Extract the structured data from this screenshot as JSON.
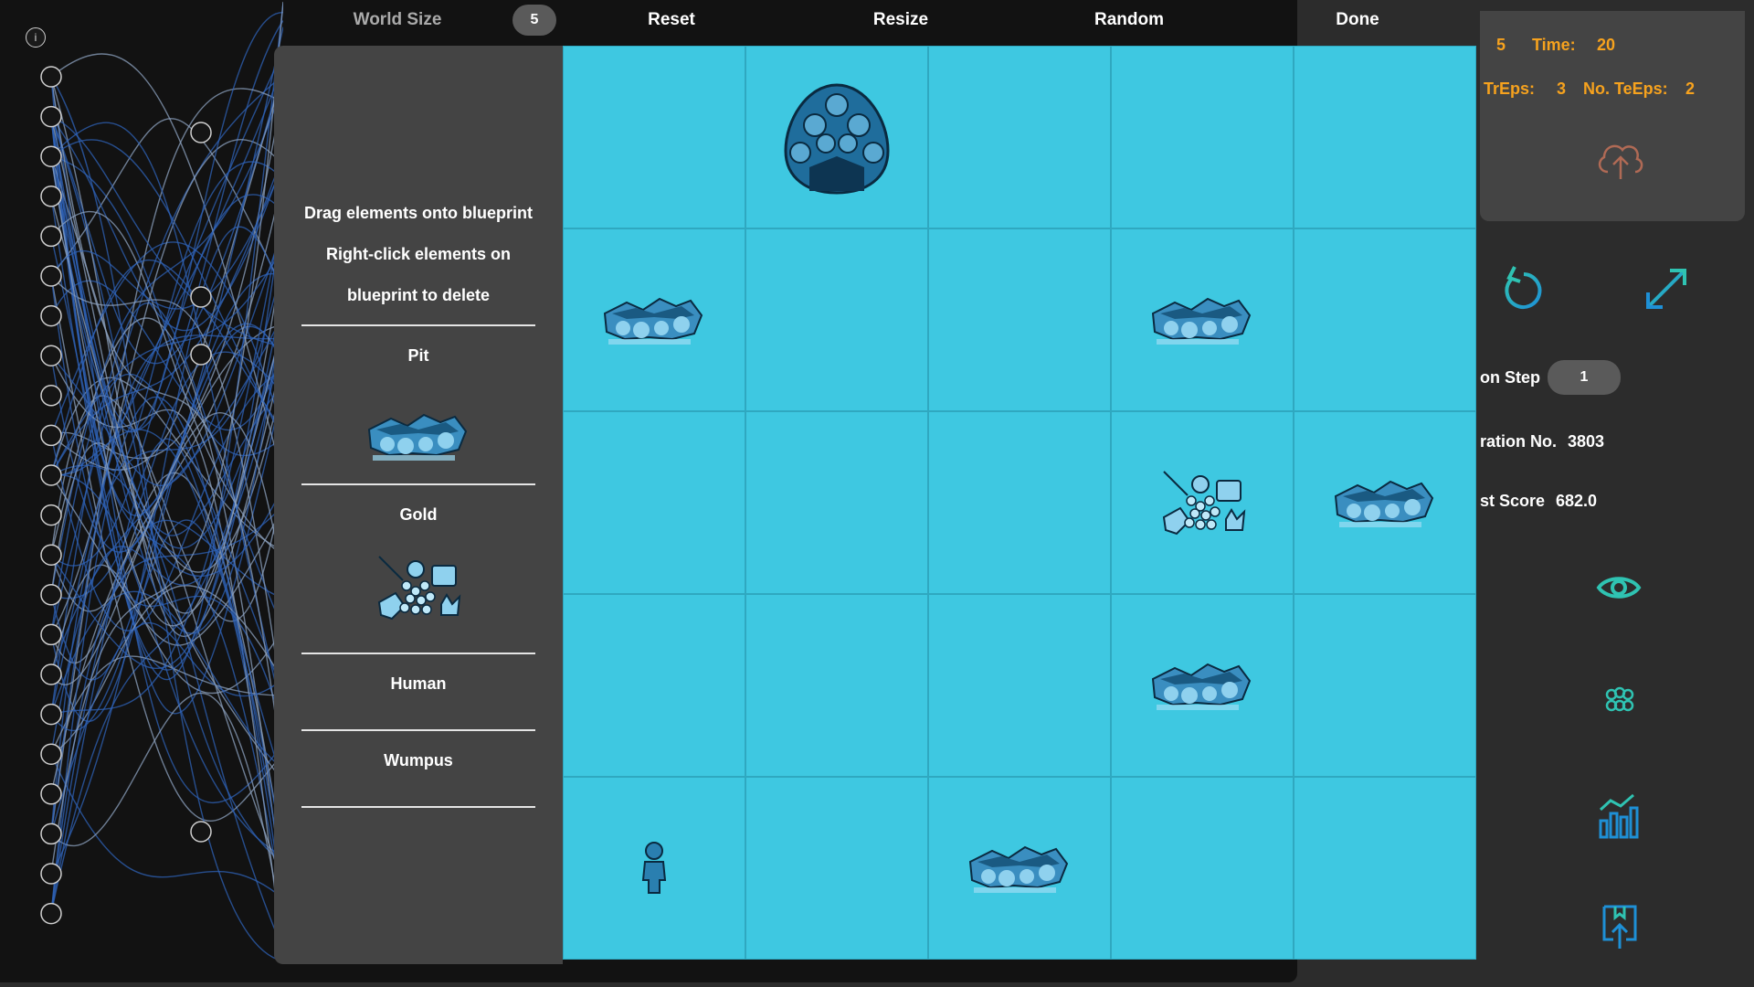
{
  "toolbar": {
    "world_size_label": "World Size",
    "world_size_value": "5",
    "reset_label": "Reset",
    "resize_label": "Resize",
    "random_label": "Random",
    "done_label": "Done"
  },
  "info_icon": "i",
  "palette": {
    "instruction_1": "Drag elements onto blueprint",
    "instruction_2": "Right-click elements on",
    "instruction_3": "blueprint to delete",
    "items": [
      {
        "label": "Pit",
        "icon": "pit-icon"
      },
      {
        "label": "Gold",
        "icon": "gold-icon"
      },
      {
        "label": "Human",
        "icon": "human-icon"
      },
      {
        "label": "Wumpus",
        "icon": "wumpus-icon"
      }
    ]
  },
  "grid": {
    "size": 5,
    "cells": [
      [
        "",
        "wumpus",
        "",
        "",
        ""
      ],
      [
        "pit",
        "",
        "",
        "pit",
        ""
      ],
      [
        "",
        "",
        "",
        "gold",
        "pit"
      ],
      [
        "",
        "",
        "",
        "pit",
        ""
      ],
      [
        "human",
        "",
        "pit",
        "",
        ""
      ]
    ]
  },
  "stats": {
    "size_value": "5",
    "time_label": "Time:",
    "time_value": "20",
    "treps_label": ". TrEps:",
    "treps_value": "3",
    "teeps_label": "No. TeEps:",
    "teeps_value": "2"
  },
  "side": {
    "step_label": "on Step",
    "step_value": "1",
    "iteration_label": "ration No.",
    "iteration_value": "3803",
    "best_score_label": "st Score",
    "best_score_value": "682.0"
  },
  "colors": {
    "grid_bg": "#3ec8e1",
    "accent_orange": "#f6a21e",
    "accent_teal": "#2fc3b2",
    "accent_blue": "#1e90d6",
    "upload_icon": "#b06a55"
  },
  "icons": [
    "upload-cloud-icon",
    "refresh-icon",
    "expand-icon",
    "eye-icon",
    "group-icon",
    "bar-chart-icon",
    "bookmark-upload-icon"
  ]
}
